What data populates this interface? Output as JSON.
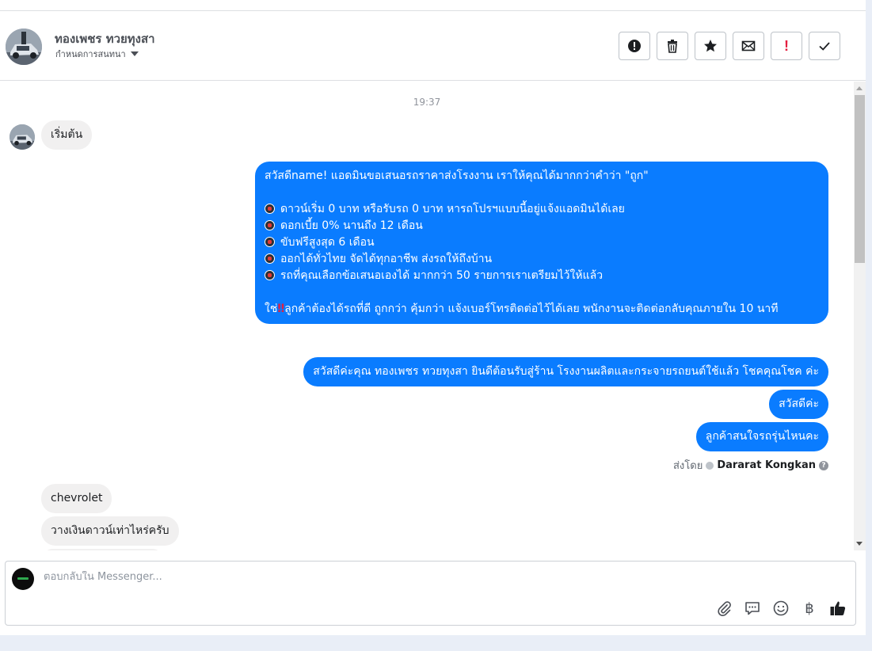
{
  "header": {
    "contact_name": "ทองเพชร ทวยทุงสา",
    "subtitle": "กำหนดการสนทนา",
    "tools": [
      {
        "name": "mark-spam-button",
        "icon": "exclamation-circle-icon"
      },
      {
        "name": "delete-button",
        "icon": "trash-icon"
      },
      {
        "name": "star-button",
        "icon": "star-icon"
      },
      {
        "name": "mark-unread-button",
        "icon": "envelope-icon"
      },
      {
        "name": "follow-up-button",
        "icon": "red-exclamation-icon",
        "label": "!"
      },
      {
        "name": "mark-done-button",
        "icon": "checkmark-icon"
      }
    ]
  },
  "thread": {
    "timestamp": "19:37",
    "messages": [
      {
        "side": "in",
        "text": "เริ่มต้น"
      },
      {
        "side": "out",
        "lines": [
          "สวัสดีname! แอดมินขอเสนอรถราคาส่งโรงงาน เราให้คุณได้มากกว่าคำว่า \"ถูก\"",
          "",
          "ดาวน์เริ่ม 0 บาท หรือรับรถ 0 บาท หารถโปรฯแบบนี้อยู่แจ้งแอดมินได้เลย",
          "ดอกเบี้ย 0% นานถึง 12 เดือน",
          "ขับฟรีสูงสุด 6 เดือน",
          "ออกได้ทั่วไทย จัดได้ทุกอาชีพ ส่งรถให้ถึงบ้าน",
          "รถที่คุณเลือกข้อเสนอเองได้ มากกว่า 50 รายการเราเตรียมไว้ให้แล้ว",
          "",
          "ใช่",
          "ลูกค้าต้องได้รถที่ดี ถูกกว่า คุ้มกว่า แจ้งเบอร์โทรติดต่อไว้ได้เลย พนักงานจะติดต่อกลับคุณภายใน 10 นาที"
        ]
      },
      {
        "side": "out",
        "text": "สวัสดีค่ะคุณ ทองเพชร ทวยทุงสา ยินดีต้อนรับสู่ร้าน โรงงานผลิตและกระจายรถยนต์ใช้แล้ว โชคคุณโชค ค่ะ"
      },
      {
        "side": "out",
        "text": "สวัสดีค่ะ"
      },
      {
        "side": "out",
        "text": "ลูกค้าสนใจรถรุ่นไหนคะ"
      },
      {
        "side": "in",
        "text": "chevrolet"
      },
      {
        "side": "in",
        "text": "วางเงินดาวน์เท่าไหร่ครับ"
      }
    ],
    "sent_by_prefix": "ส่งโดย",
    "sent_by_agent": "Dararat Kongkan"
  },
  "composer": {
    "placeholder": "ตอบกลับใน Messenger...",
    "tools": [
      "paperclip-icon",
      "saved-reply-icon",
      "emoji-icon",
      "baht-icon",
      "thumbs-up-icon"
    ],
    "baht_symbol": "฿"
  }
}
